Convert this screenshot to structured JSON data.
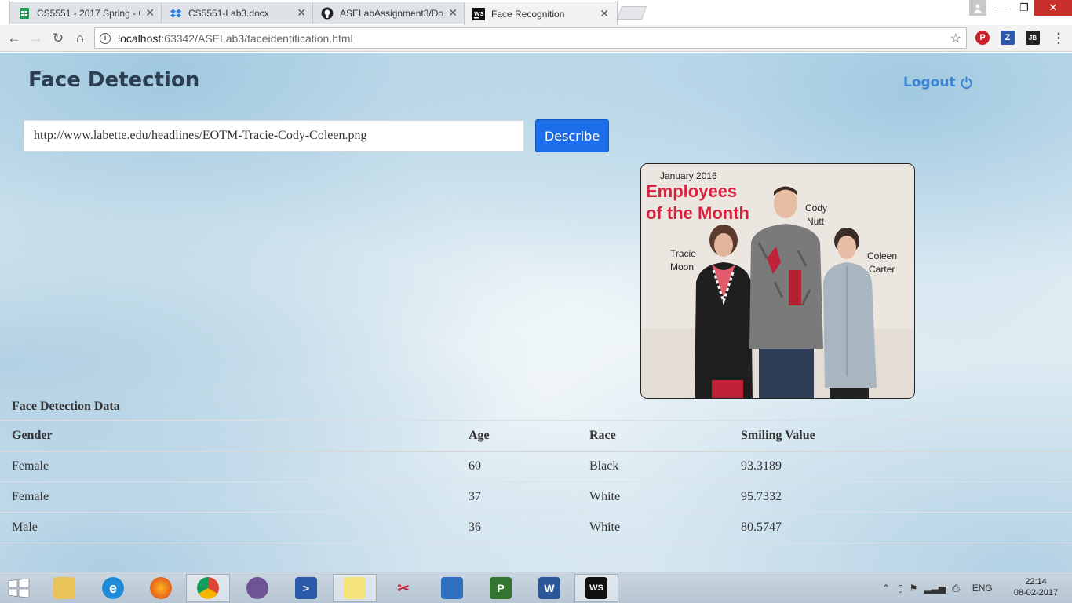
{
  "browser": {
    "tabs": [
      {
        "label": "CS5551 - 2017 Spring - G",
        "icon": "google-sheets-icon"
      },
      {
        "label": "CS5551-Lab3.docx",
        "icon": "dropbox-icon"
      },
      {
        "label": "ASELabAssignment3/Doc",
        "icon": "github-icon"
      },
      {
        "label": "Face Recognition",
        "icon": "webstorm-icon"
      }
    ],
    "address": {
      "host": "localhost",
      "rest": ":63342/ASELab3/faceidentification.html"
    }
  },
  "header": {
    "title": "Face Detection",
    "logout_label": "Logout"
  },
  "search": {
    "url_value": "http://www.labette.edu/headlines/EOTM-Tracie-Cody-Coleen.png",
    "button_label": "Describe"
  },
  "photo": {
    "date_text": "January 2016",
    "headline_line1": "Employees",
    "headline_line2": "of the Month",
    "people": [
      {
        "first": "Tracie",
        "last": "Moon"
      },
      {
        "first": "Cody",
        "last": "Nutt"
      },
      {
        "first": "Coleen",
        "last": "Carter"
      }
    ],
    "colors": {
      "headline": "#d9223f"
    }
  },
  "table": {
    "caption": "Face Detection Data",
    "columns": [
      "Gender",
      "Age",
      "Race",
      "Smiling Value"
    ],
    "rows": [
      {
        "gender": "Female",
        "age": "60",
        "race": "Black",
        "smiling": "93.3189"
      },
      {
        "gender": "Female",
        "age": "37",
        "race": "White",
        "smiling": "95.7332"
      },
      {
        "gender": "Male",
        "age": "36",
        "race": "White",
        "smiling": "80.5747"
      }
    ]
  },
  "taskbar": {
    "language": "ENG",
    "time": "22:14",
    "date": "08-02-2017"
  }
}
